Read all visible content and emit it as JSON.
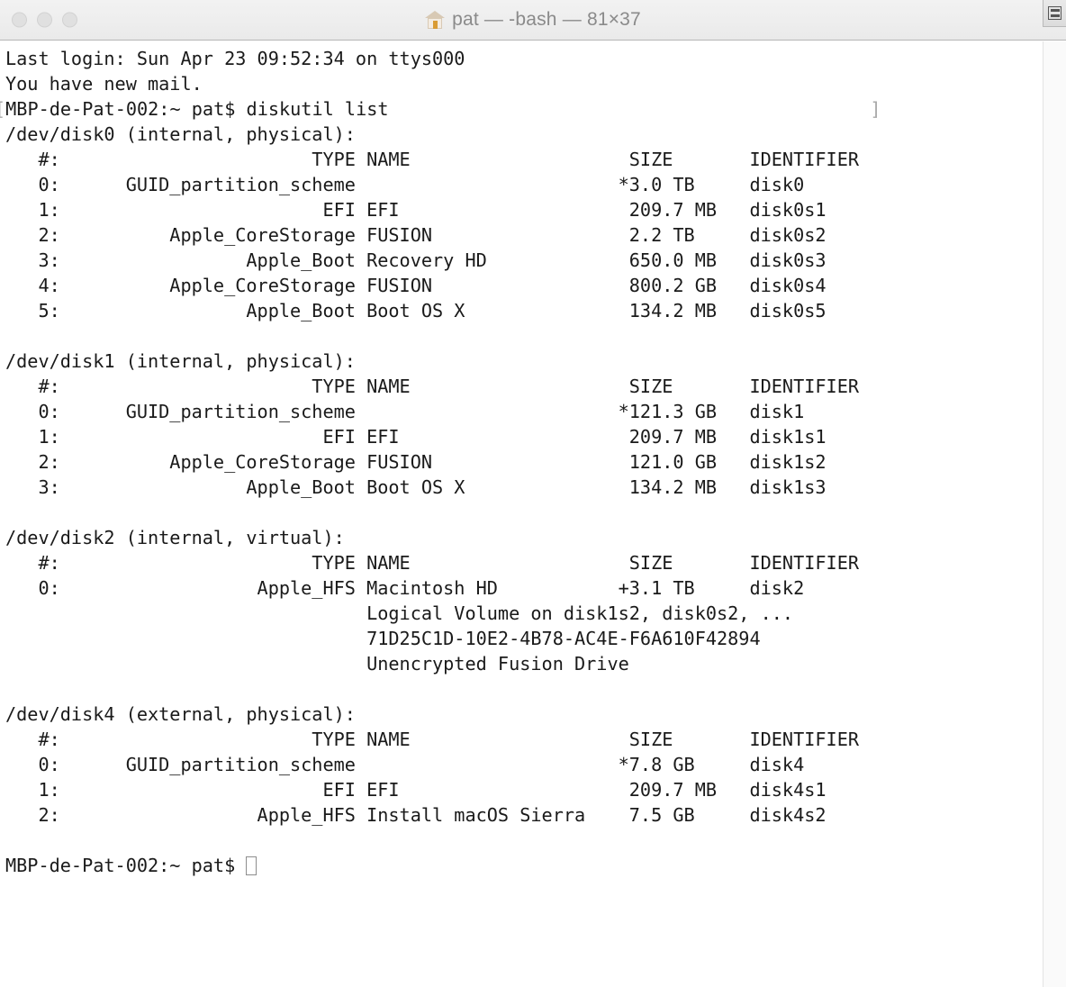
{
  "window": {
    "title": "pat — -bash — 81×37",
    "icon": "home-icon",
    "cols": 81,
    "rows": 37,
    "background_color": "#ffffff",
    "text_color": "#1a1a1a",
    "titlebar_color": "#eaeaea",
    "traffic_lights": [
      {
        "name": "close",
        "color": "#e0e0e0"
      },
      {
        "name": "minimize",
        "color": "#e0e0e0"
      },
      {
        "name": "zoom",
        "color": "#e0e0e0"
      }
    ],
    "scrollbar": {
      "split_pane_button": "split-pane-icon"
    }
  },
  "terminal": {
    "marker_open": "[",
    "marker_close": "]",
    "cursor": "block-outline",
    "lines": [
      "Last login: Sun Apr 23 09:52:34 on ttys000",
      "You have new mail.",
      "MBP-de-Pat-002:~ pat$ diskutil list",
      "/dev/disk0 (internal, physical):",
      "   #:                       TYPE NAME                    SIZE       IDENTIFIER",
      "   0:      GUID_partition_scheme                        *3.0 TB     disk0",
      "   1:                        EFI EFI                     209.7 MB   disk0s1",
      "   2:          Apple_CoreStorage FUSION                  2.2 TB     disk0s2",
      "   3:                 Apple_Boot Recovery HD             650.0 MB   disk0s3",
      "   4:          Apple_CoreStorage FUSION                  800.2 GB   disk0s4",
      "   5:                 Apple_Boot Boot OS X               134.2 MB   disk0s5",
      "",
      "/dev/disk1 (internal, physical):",
      "   #:                       TYPE NAME                    SIZE       IDENTIFIER",
      "   0:      GUID_partition_scheme                        *121.3 GB   disk1",
      "   1:                        EFI EFI                     209.7 MB   disk1s1",
      "   2:          Apple_CoreStorage FUSION                  121.0 GB   disk1s2",
      "   3:                 Apple_Boot Boot OS X               134.2 MB   disk1s3",
      "",
      "/dev/disk2 (internal, virtual):",
      "   #:                       TYPE NAME                    SIZE       IDENTIFIER",
      "   0:                  Apple_HFS Macintosh HD           +3.1 TB     disk2",
      "                                 Logical Volume on disk1s2, disk0s2, ...",
      "                                 71D25C1D-10E2-4B78-AC4E-F6A610F42894",
      "                                 Unencrypted Fusion Drive",
      "",
      "/dev/disk4 (external, physical):",
      "   #:                       TYPE NAME                    SIZE       IDENTIFIER",
      "   0:      GUID_partition_scheme                        *7.8 GB     disk4",
      "   1:                        EFI EFI                     209.7 MB   disk4s1",
      "   2:                  Apple_HFS Install macOS Sierra    7.5 GB     disk4s2",
      "",
      "MBP-de-Pat-002:~ pat$ "
    ],
    "prompt_line_index": 2,
    "final_prompt_index": 32,
    "command": "diskutil list",
    "prompt": "MBP-de-Pat-002:~ pat$"
  }
}
